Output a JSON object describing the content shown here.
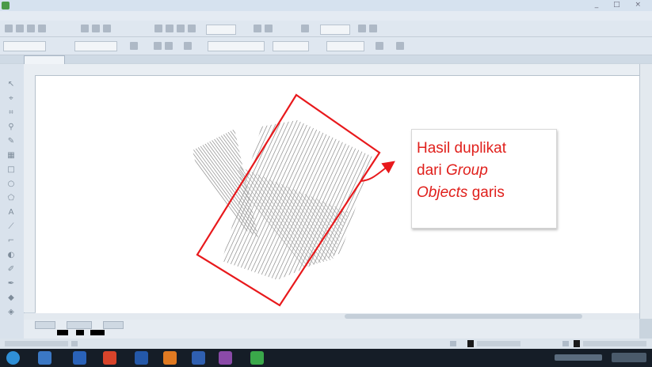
{
  "annotation": {
    "line1": "Hasil duplikat",
    "line2_prefix": "dari ",
    "line2_italic": "Group",
    "line3_italic": "Objects",
    "line3_suffix": " garis",
    "color": "#e0201c"
  },
  "window": {
    "controls": "_ □ ×"
  },
  "icons": {
    "app": "corel-app-icon",
    "tools": [
      "pick-tool-icon",
      "shape-tool-icon",
      "crop-tool-icon",
      "zoom-tool-icon",
      "freehand-tool-icon",
      "smart-fill-icon",
      "rectangle-tool-icon",
      "ellipse-tool-icon",
      "polygon-tool-icon",
      "text-tool-icon",
      "parallel-dimension-icon",
      "connector-tool-icon",
      "blend-tool-icon",
      "eyedropper-icon",
      "outline-pen-icon",
      "fill-tool-icon",
      "interactive-fill-icon"
    ]
  },
  "colors": {
    "selection_outline": "#e8191c",
    "lines": "#9a9a9a"
  }
}
